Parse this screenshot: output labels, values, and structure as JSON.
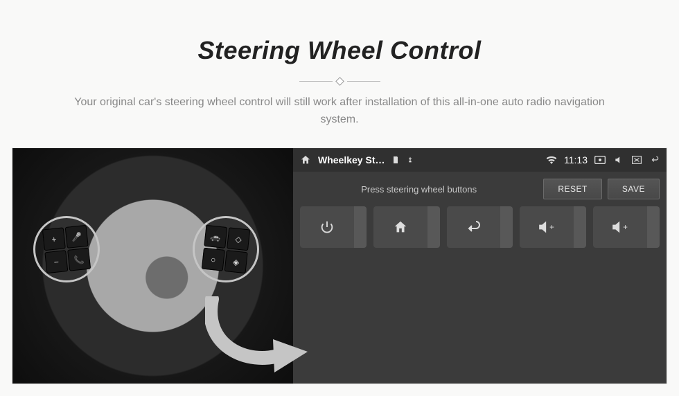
{
  "hero": {
    "title": "Steering Wheel Control",
    "subtitle": "Your original car's steering wheel control will still work after installation of this all-in-one auto radio navigation system."
  },
  "wheel": {
    "left_pad": [
      "+",
      "🎤",
      "−",
      "📞"
    ],
    "right_pad": [
      "🚗",
      "◇",
      "○",
      "◈"
    ]
  },
  "statusbar": {
    "home_icon": "home-icon",
    "app_title": "Wheelkey St…",
    "indicators": [
      "sd-icon",
      "usb-icon"
    ],
    "wifi_icon": "wifi-icon",
    "time": "11:13",
    "right_icons": [
      "cast-icon",
      "mute-icon",
      "window-icon",
      "back-icon"
    ]
  },
  "mapper": {
    "prompt": "Press steering wheel buttons",
    "reset_label": "RESET",
    "save_label": "SAVE",
    "tiles": [
      {
        "name": "power",
        "icon": "⏻"
      },
      {
        "name": "home",
        "icon": "⌂"
      },
      {
        "name": "previous",
        "icon": "↶"
      },
      {
        "name": "volume-up-1",
        "icon": "🔊+"
      },
      {
        "name": "volume-up-2",
        "icon": "🔊+"
      }
    ]
  }
}
